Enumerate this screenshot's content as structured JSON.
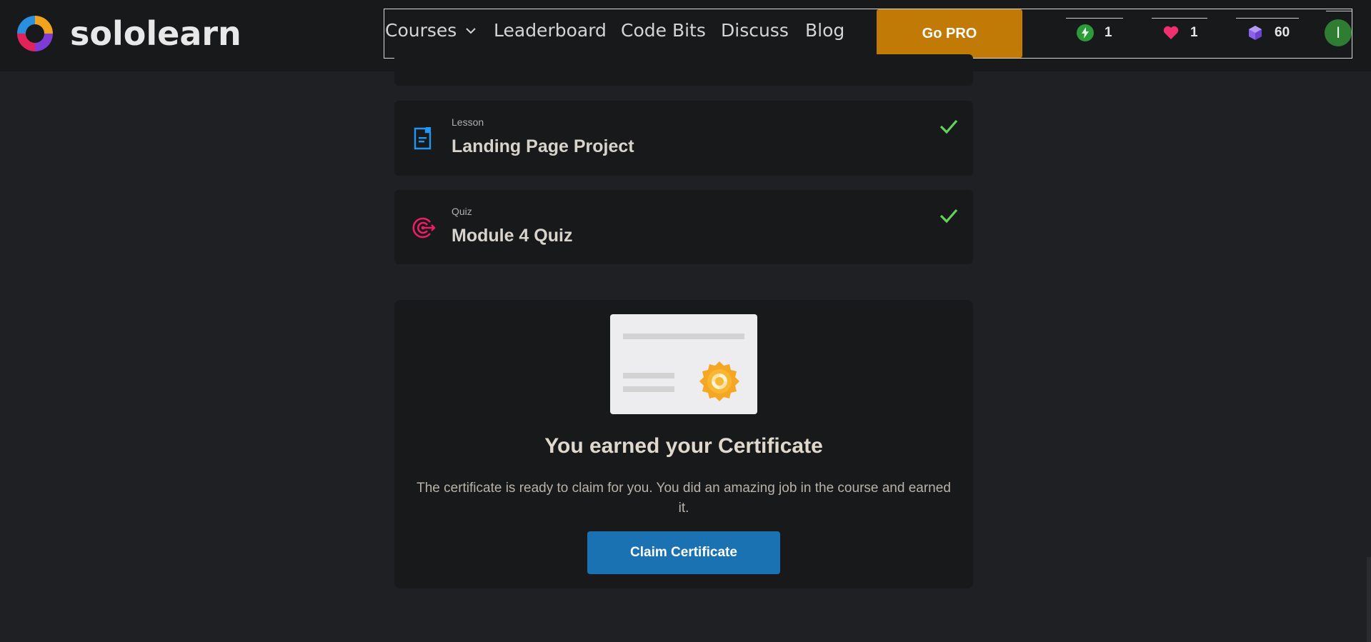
{
  "app": {
    "logo_text": "sololearn",
    "logo_icon": "sololearn-logo-icon"
  },
  "nav": {
    "courses": "Courses",
    "leaderboard": "Leaderboard",
    "code_bits": "Code Bits",
    "discuss": "Discuss",
    "blog": "Blog",
    "go_pro": "Go PRO"
  },
  "stats": {
    "streak": "1",
    "hearts": "1",
    "gems": "60",
    "avatar_initial": "I"
  },
  "items": [
    {
      "kind": "Lesson",
      "title": "Landing Page Project",
      "icon": "lesson-doc-icon",
      "completed": true
    },
    {
      "kind": "Quiz",
      "title": "Module 4 Quiz",
      "icon": "quiz-target-icon",
      "completed": true
    }
  ],
  "certificate": {
    "heading": "You earned your Certificate",
    "text": "The certificate is ready to claim for you. You did an amazing job in the course and earned it.",
    "button": "Claim Certificate"
  },
  "colors": {
    "background": "#1f2023",
    "card": "#18191b",
    "go_pro": "#c27a06",
    "claim": "#1b72b3",
    "check": "#62d25a",
    "lesson_icon": "#2196f3",
    "quiz_icon": "#e91e63"
  }
}
